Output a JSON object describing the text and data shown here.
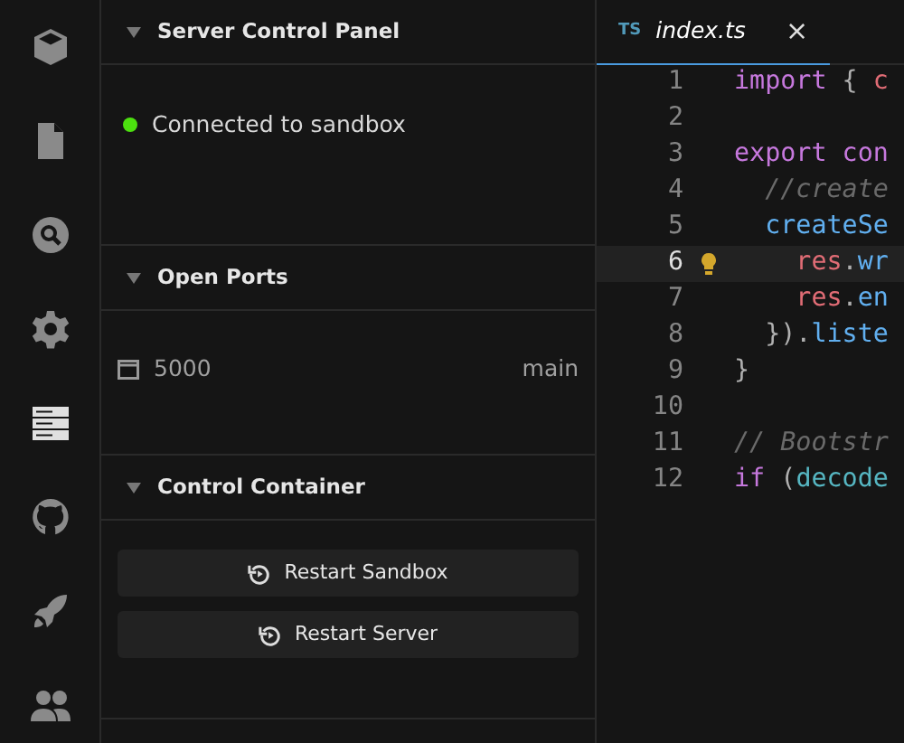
{
  "activity_bar": [
    {
      "kind": "cube",
      "selected": false
    },
    {
      "kind": "file",
      "selected": false
    },
    {
      "kind": "search",
      "selected": false
    },
    {
      "kind": "gear",
      "selected": false
    },
    {
      "kind": "server",
      "selected": true
    },
    {
      "kind": "github",
      "selected": false
    },
    {
      "kind": "rocket",
      "selected": false
    },
    {
      "kind": "users",
      "selected": false
    }
  ],
  "sections": [
    {
      "title": "Server Control Panel",
      "expanded": true,
      "kind": "status",
      "status": {
        "text": "Connected to sandbox",
        "color": "#4ce00f"
      }
    },
    {
      "title": "Open Ports",
      "expanded": true,
      "kind": "ports",
      "ports": [
        {
          "port": "5000",
          "label": "main"
        }
      ]
    },
    {
      "title": "Control Container",
      "expanded": true,
      "kind": "buttons",
      "buttons": [
        "Restart Sandbox",
        "Restart Server"
      ]
    }
  ],
  "editor": {
    "tab": {
      "badge": "TS",
      "name": "index.ts",
      "close": "×",
      "selected": true
    },
    "lines": [
      {
        "number": "1",
        "active": false,
        "tokens": [
          {
            "kind": "keyword",
            "text": "import"
          },
          {
            "kind": "punct",
            "text": " { "
          },
          {
            "kind": "variable",
            "text": "c"
          }
        ]
      },
      {
        "number": "2",
        "active": false
      },
      {
        "number": "3",
        "active": false,
        "tokens": [
          {
            "kind": "keyword",
            "text": "export"
          },
          {
            "kind": "keyword",
            "text": " con"
          }
        ]
      },
      {
        "number": "4",
        "active": false,
        "tokens": [
          {
            "kind": "comment",
            "text": "  //create"
          }
        ]
      },
      {
        "number": "5",
        "active": false,
        "tokens": [
          {
            "kind": "function",
            "text": "  createSe"
          }
        ]
      },
      {
        "number": "6",
        "active": true,
        "tokens": [
          {
            "kind": "variable",
            "text": "    res"
          },
          {
            "kind": "punct",
            "text": "."
          },
          {
            "kind": "function",
            "text": "wr"
          }
        ]
      },
      {
        "number": "7",
        "active": false,
        "tokens": [
          {
            "kind": "variable",
            "text": "    res"
          },
          {
            "kind": "punct",
            "text": "."
          },
          {
            "kind": "function",
            "text": "en"
          }
        ]
      },
      {
        "number": "8",
        "active": false,
        "tokens": [
          {
            "kind": "punct",
            "text": "  })."
          },
          {
            "kind": "function",
            "text": "liste"
          }
        ]
      },
      {
        "number": "9",
        "active": false,
        "tokens": [
          {
            "kind": "punct",
            "text": "}"
          }
        ]
      },
      {
        "number": "10",
        "active": false
      },
      {
        "number": "11",
        "active": false,
        "tokens": [
          {
            "kind": "comment",
            "text": "// Bootstr"
          }
        ]
      },
      {
        "number": "12",
        "active": false,
        "tokens": [
          {
            "kind": "keyword",
            "text": "if"
          },
          {
            "kind": "punct",
            "text": " ("
          },
          {
            "kind": "type",
            "text": "decode"
          }
        ]
      }
    ]
  }
}
